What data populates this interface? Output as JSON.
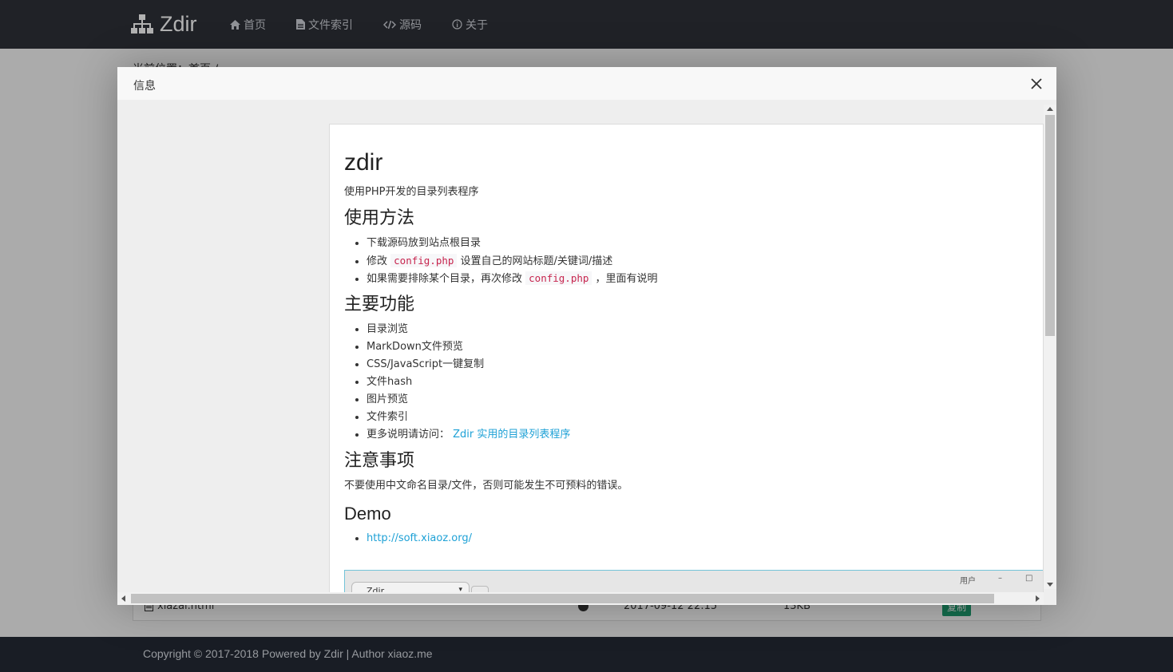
{
  "navbar": {
    "brand": "Zdir",
    "items": [
      {
        "label": "首页",
        "icon": "home-icon"
      },
      {
        "label": "文件索引",
        "icon": "file-icon"
      },
      {
        "label": "源码",
        "icon": "code-icon"
      },
      {
        "label": "关于",
        "icon": "info-icon"
      }
    ]
  },
  "background": {
    "breadcrumb": "当前位置：首页 /",
    "row": {
      "filename": "xiazai.html",
      "time": "2017-09-12 22:15",
      "size": "13KB",
      "action": "复制"
    }
  },
  "footer": {
    "text": "Copyright © 2017-2018 Powered by Zdir | Author xiaoz.me"
  },
  "modal": {
    "title": "信息",
    "article": {
      "h1": "zdir",
      "intro": "使用PHP开发的目录列表程序",
      "usage": {
        "heading": "使用方法",
        "item1": "下载源码放到站点根目录",
        "item2_pre": "修改 ",
        "item2_code": "config.php",
        "item2_post": " 设置自己的网站标题/关键词/描述",
        "item3_pre": "如果需要排除某个目录，再次修改 ",
        "item3_code": "config.php",
        "item3_post": " ，里面有说明"
      },
      "features": {
        "heading": "主要功能",
        "items": [
          "目录浏览",
          "MarkDown文件预览",
          "CSS/JavaScript一键复制",
          "文件hash",
          "图片预览",
          "文件索引"
        ],
        "more_pre": "更多说明请访问： ",
        "more_link": "Zdir 实用的目录列表程序"
      },
      "notes": {
        "heading": "注意事项",
        "text": "不要使用中文命名目录/文件，否则可能发生不可预料的错误。"
      },
      "demo": {
        "heading": "Demo",
        "link": "http://soft.xiaoz.org/"
      },
      "screenshot": {
        "tab": "Zdir",
        "user": "用户",
        "min": "–",
        "max": "□"
      }
    }
  },
  "colors": {
    "navbar": "#2e3139",
    "footer": "#242a35",
    "link": "#1ea1d6",
    "code": "#c7254e",
    "copy_button": "#1e9e70"
  }
}
